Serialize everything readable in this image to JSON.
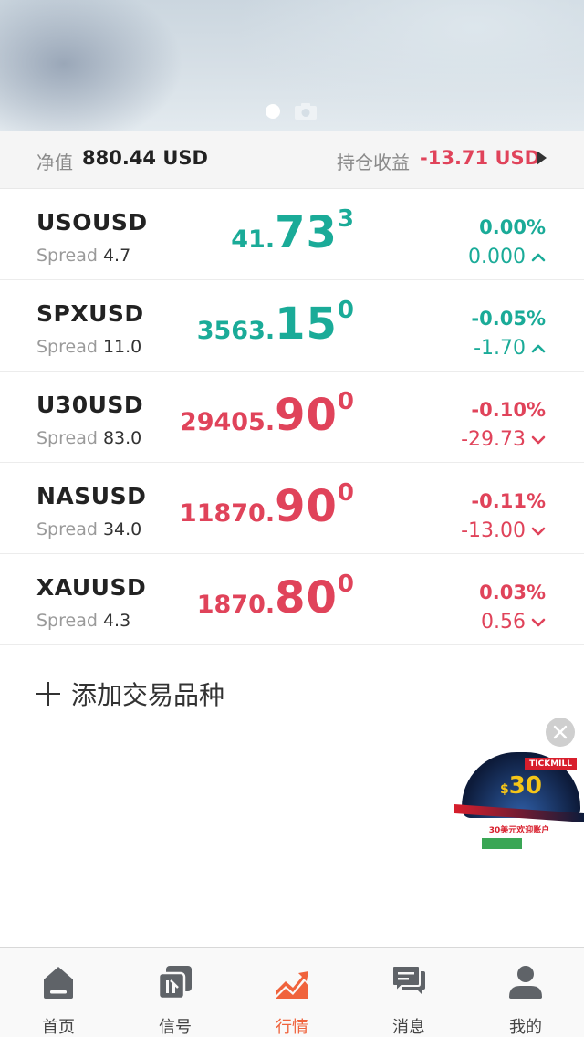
{
  "equity": {
    "label": "净值",
    "value": "880.44 USD",
    "pnl_label": "持仓收益",
    "pnl_value": "-13.71 USD"
  },
  "quotes": [
    {
      "symbol": "USOUSD",
      "spread_label": "Spread",
      "spread": "4.7",
      "price_int": "41.",
      "price_big": "73",
      "price_sup": "3",
      "pct": "0.00%",
      "change": "0.000",
      "direction": "up",
      "color": "#1aab98"
    },
    {
      "symbol": "SPXUSD",
      "spread_label": "Spread",
      "spread": "11.0",
      "price_int": "3563.",
      "price_big": "15",
      "price_sup": "0",
      "pct": "-0.05%",
      "change": "-1.70",
      "direction": "up",
      "color": "#1aab98"
    },
    {
      "symbol": "U30USD",
      "spread_label": "Spread",
      "spread": "83.0",
      "price_int": "29405.",
      "price_big": "90",
      "price_sup": "0",
      "pct": "-0.10%",
      "change": "-29.73",
      "direction": "down",
      "color": "#e0435a"
    },
    {
      "symbol": "NASUSD",
      "spread_label": "Spread",
      "spread": "34.0",
      "price_int": "11870.",
      "price_big": "90",
      "price_sup": "0",
      "pct": "-0.11%",
      "change": "-13.00",
      "direction": "down",
      "color": "#e0435a"
    },
    {
      "symbol": "XAUUSD",
      "spread_label": "Spread",
      "spread": "4.3",
      "price_int": "1870.",
      "price_big": "80",
      "price_sup": "0",
      "pct": "0.03%",
      "change": "0.56",
      "direction": "down",
      "color": "#e0435a"
    }
  ],
  "add_instrument": "添加交易品种",
  "ad": {
    "brand": "TICKMILL",
    "amount_symbol": "$",
    "amount": "30",
    "headline": "30美元欢迎账户"
  },
  "tabs": [
    {
      "label": "首页",
      "icon": "home-icon"
    },
    {
      "label": "信号",
      "icon": "signal-icon"
    },
    {
      "label": "行情",
      "icon": "market-chart-icon",
      "active": true
    },
    {
      "label": "消息",
      "icon": "message-icon"
    },
    {
      "label": "我的",
      "icon": "profile-icon"
    }
  ],
  "colors": {
    "up": "#1aab98",
    "down": "#e0435a",
    "accent": "#f0633c"
  }
}
